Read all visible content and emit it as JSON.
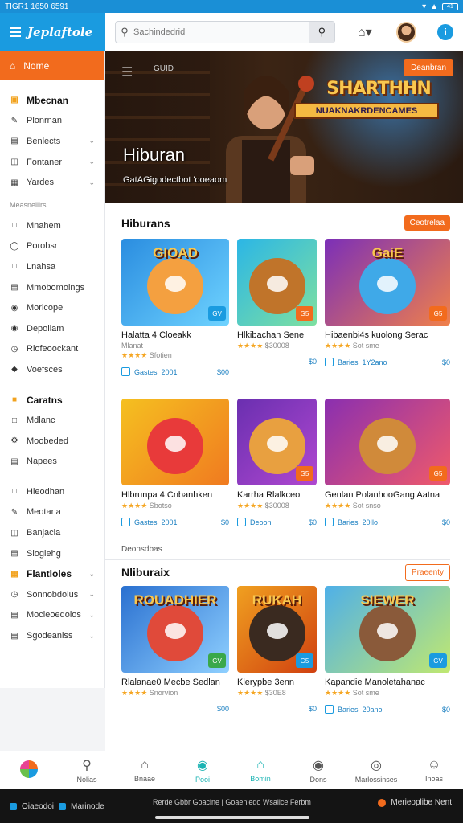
{
  "status": {
    "time": "TIGR1 1650 6591",
    "battery": "41"
  },
  "brand": {
    "name": "Jeplaftole"
  },
  "search": {
    "placeholder": "Sachindedrid"
  },
  "sidebar": {
    "active": "Nome",
    "group1": [
      {
        "label": "Mbecnan",
        "icon": "book-icon",
        "bold": true
      },
      {
        "label": "Plonrnan",
        "icon": "pencil-icon"
      },
      {
        "label": "Benlects",
        "icon": "bag-icon",
        "chev": true
      },
      {
        "label": "Fontaner",
        "icon": "folder-icon",
        "chev": true
      },
      {
        "label": "Yardes",
        "icon": "grid-icon",
        "chev": true
      }
    ],
    "section_label": "Measnellirs",
    "group2": [
      {
        "label": "Mnahem",
        "icon": "square-icon"
      },
      {
        "label": "Porobsr",
        "icon": "circle-icon"
      },
      {
        "label": "Lnahsa",
        "icon": "bookmark-icon"
      },
      {
        "label": "Mmobomolngs",
        "icon": "table-icon"
      },
      {
        "label": "Moricope",
        "icon": "pin-icon"
      },
      {
        "label": "Depoliam",
        "icon": "chat-icon"
      },
      {
        "label": "Rlofeoockant",
        "icon": "clock-icon"
      },
      {
        "label": "Voefsces",
        "icon": "game-icon"
      }
    ],
    "group3": [
      {
        "label": "Caratns",
        "icon": "star-icon",
        "bold": true
      },
      {
        "label": "Mdlanc",
        "icon": "bookmark-icon"
      },
      {
        "label": "Moobeded",
        "icon": "settings-icon"
      },
      {
        "label": "Napees",
        "icon": "file-icon"
      }
    ],
    "group4": [
      {
        "label": "Hleodhan",
        "icon": "square-icon"
      },
      {
        "label": "Meotarla",
        "icon": "pencil-icon"
      },
      {
        "label": "Banjacla",
        "icon": "folder-icon"
      },
      {
        "label": "Slogiehg",
        "icon": "table-icon"
      },
      {
        "label": "Flantloles",
        "icon": "grid-icon",
        "chev": true,
        "bold": true
      },
      {
        "label": "Sonnobdoius",
        "icon": "clock-icon",
        "chev": true
      },
      {
        "label": "Mocleoedolos",
        "icon": "table-icon",
        "chev": true
      },
      {
        "label": "Sgodeaniss",
        "icon": "file-icon",
        "chev": true
      }
    ]
  },
  "hero": {
    "breadcrumb": "GUID",
    "cta": "Deanbran",
    "game_title": "SHARTHHN",
    "game_subtitle": "NUAKNAKRDENCAMES",
    "title": "Hiburan",
    "subtitle": "GatAGigodectbot 'ooeaom"
  },
  "section1": {
    "title": "Hiburans",
    "more": "Ceotrelaa",
    "cards": [
      {
        "thumb_title": "GIOAD",
        "name": "Halatta 4 Cloeakk",
        "meta": "Mlanat",
        "rating": "Sfotien",
        "tag": "Gastes",
        "count": "2001",
        "price": "$00",
        "corner": "GV",
        "colors": [
          "#2a8de0",
          "#6fd3ff"
        ],
        "fig": "#f4a040",
        "corner_color": "#1a9be0"
      },
      {
        "thumb_title": "",
        "name": "Hlkibachan Sene",
        "meta": "",
        "rating": "$30008",
        "tag": "",
        "count": "",
        "price": "$0",
        "corner": "G5",
        "colors": [
          "#2bb6e6",
          "#7ee0a0"
        ],
        "fig": "#c0742a",
        "corner_color": "#f26b1d"
      },
      {
        "thumb_title": "GaiE",
        "name": "Hibaenbi4s kuolong Serac",
        "meta": "",
        "rating": "Sot sme",
        "tag": "Baries",
        "count": "1Y2ano",
        "price": "$0",
        "corner": "G5",
        "colors": [
          "#7b2fb8",
          "#f0804a"
        ],
        "fig": "#3fa9e8",
        "corner_color": "#f26b1d"
      }
    ]
  },
  "section2": {
    "cards": [
      {
        "thumb_title": "",
        "name": "Hlbrunpa 4 Cnbanhken",
        "meta": "",
        "rating": "Sbotso",
        "tag": "Gastes",
        "count": "2001",
        "price": "$0",
        "corner": "",
        "colors": [
          "#f5c020",
          "#f07a20"
        ],
        "fig": "#e83a3a",
        "corner_color": "#f26b1d"
      },
      {
        "thumb_title": "",
        "name": "Karrha Rlalkceo",
        "meta": "",
        "rating": "$30008",
        "tag": "Deoon",
        "count": "",
        "price": "$0",
        "corner": "G5",
        "colors": [
          "#6a2fb0",
          "#b048d0"
        ],
        "fig": "#e8a040",
        "corner_color": "#f26b1d"
      },
      {
        "thumb_title": "",
        "name": "Genlan PolanhooGang Aatna",
        "meta": "",
        "rating": "Sot snso",
        "tag": "Baries",
        "count": "20Ilo",
        "price": "$0",
        "corner": "G5",
        "colors": [
          "#8a2fb0",
          "#f05a6a"
        ],
        "fig": "#d08a3a",
        "corner_color": "#f26b1d"
      }
    ]
  },
  "section3": {
    "label": "Deonsdbas",
    "title": "Nliburaix",
    "more": "Praeenty",
    "cards": [
      {
        "thumb_title": "ROUADHIER",
        "name": "Rlalanae0 Mecbe Sedlan",
        "meta": "",
        "rating": "Snorvion",
        "tag": "",
        "count": "",
        "price": "$00",
        "corner": "GV",
        "colors": [
          "#2a70d0",
          "#8fd0ff"
        ],
        "fig": "#e04a3a",
        "corner_color": "#3aa84a"
      },
      {
        "thumb_title": "RUKAH",
        "name": "Klerypbe 3enn",
        "meta": "",
        "rating": "$30E8",
        "tag": "",
        "count": "",
        "price": "$0",
        "corner": "G5",
        "colors": [
          "#f0a020",
          "#d04010"
        ],
        "fig": "#3a2a20",
        "corner_color": "#1a9be0"
      },
      {
        "thumb_title": "SIEWER",
        "name": "Kapandie Manoletahanac",
        "meta": "",
        "rating": "Sot sme",
        "tag": "Baries",
        "count": "20ano",
        "price": "$0",
        "corner": "GV",
        "colors": [
          "#4fb0e8",
          "#c0e870"
        ],
        "fig": "#8a5a3a",
        "corner_color": "#1a9be0"
      }
    ]
  },
  "bottomnav": [
    {
      "label": "",
      "icon": "app-icon"
    },
    {
      "label": "Nolias",
      "icon": "search-icon"
    },
    {
      "label": "Bnaae",
      "icon": "home-icon"
    },
    {
      "label": "Pooi",
      "icon": "pin-icon",
      "active": true
    },
    {
      "label": "Bomin",
      "icon": "store-icon",
      "active": true
    },
    {
      "label": "Dons",
      "icon": "bell-icon"
    },
    {
      "label": "Marlossinses",
      "icon": "globe-icon"
    },
    {
      "label": "Inoas",
      "icon": "user-icon"
    }
  ],
  "sysbar": {
    "left1": "Oiaeodoi",
    "left2": "Marinode",
    "center": "Rerde Gbbr Goacine | Goaeniedo Wsalice Ferbm",
    "right": "Merieoplibe Nent"
  }
}
